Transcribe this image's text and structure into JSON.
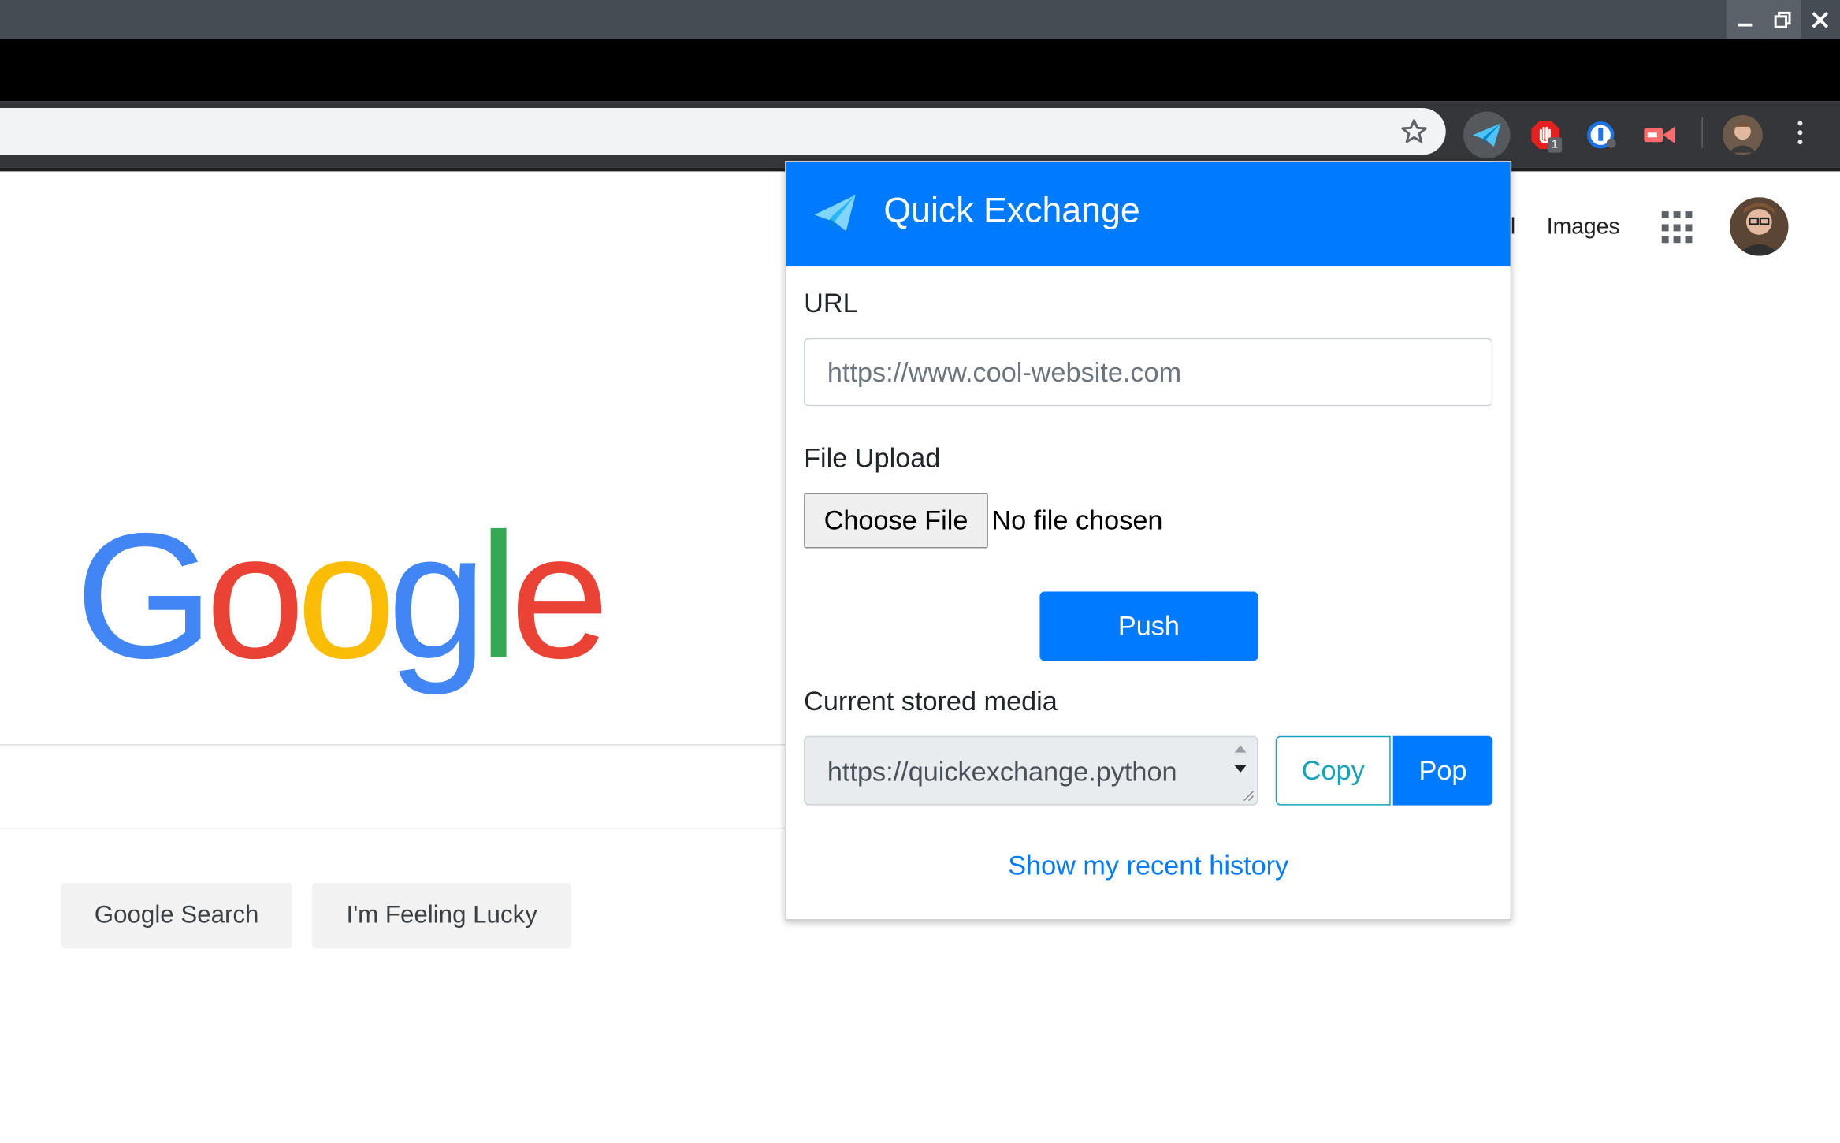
{
  "window_controls": {
    "minimize_icon": "minimize-icon",
    "maximize_icon": "restore-icon",
    "close_icon": "close-icon"
  },
  "toolbar": {
    "bookmark_icon": "star-icon",
    "extensions": [
      {
        "name": "paper-plane-icon",
        "active": true
      },
      {
        "name": "adblock-hand-icon",
        "badge": "1"
      },
      {
        "name": "password-manager-icon"
      },
      {
        "name": "video-recorder-icon"
      }
    ],
    "menu_icon": "kebab-menu-icon"
  },
  "google": {
    "header_links": {
      "gmail_partial": "il",
      "images": "Images"
    },
    "logo_letters": [
      {
        "char": "G",
        "color": "#4285f4"
      },
      {
        "char": "o",
        "color": "#ea4335"
      },
      {
        "char": "o",
        "color": "#fbbc05"
      },
      {
        "char": "g",
        "color": "#4285f4"
      },
      {
        "char": "l",
        "color": "#34a853"
      },
      {
        "char": "e",
        "color": "#ea4335"
      }
    ],
    "buttons": {
      "search": "Google Search",
      "lucky": "I'm Feeling Lucky"
    }
  },
  "popup": {
    "title": "Quick Exchange",
    "url_label": "URL",
    "url_placeholder": "https://www.cool-website.com",
    "file_label": "File Upload",
    "choose_file": "Choose File",
    "no_file": "No file chosen",
    "push": "Push",
    "stored_label": "Current stored media",
    "stored_value": "https://quickexchange.python",
    "copy": "Copy",
    "pop": "Pop",
    "history_link": "Show my recent history"
  },
  "colors": {
    "primary": "#007bff",
    "info": "#17a2b8",
    "title_bar": "#454c53",
    "toolbar": "#35363a"
  }
}
